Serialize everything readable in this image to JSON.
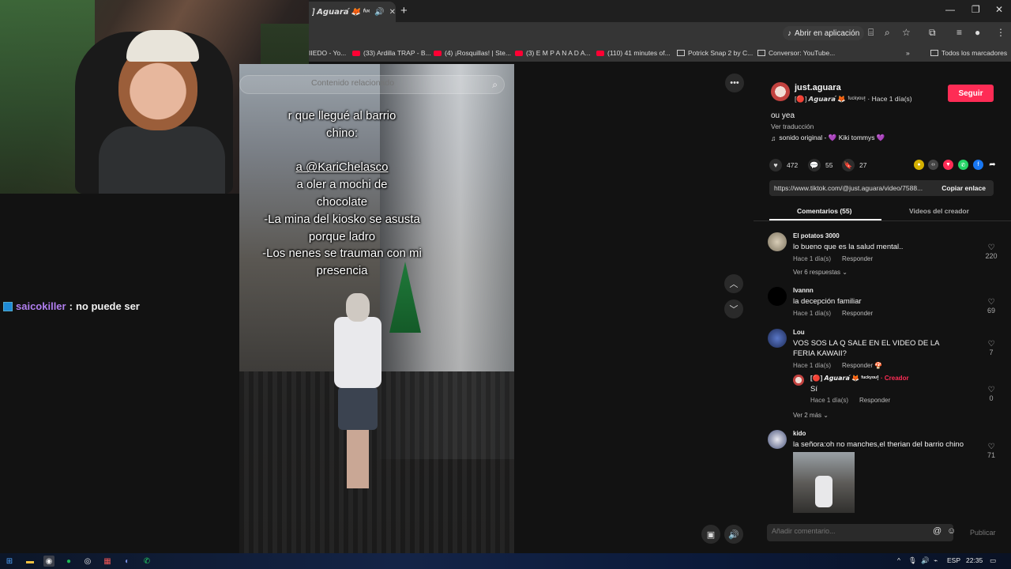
{
  "browser": {
    "tab_title": "] 𝘼𝙜𝙪𝙖𝙧𝙖́ 🦊 ᶠᵘᶜᵏʸᵒᵘ!",
    "new_tab": "+",
    "open_in_app": "Abrir en aplicación",
    "window_controls": [
      "—",
      "❐",
      "✕"
    ]
  },
  "bookmarks": [
    {
      "label": "IIEDO - Yo...",
      "icon": "youtube-icon"
    },
    {
      "label": "(33) Ardilla TRAP - B...",
      "icon": "youtube-icon"
    },
    {
      "label": "(4) ¡Rosquillas! | Ste...",
      "icon": "youtube-icon"
    },
    {
      "label": "(3) E M P A N A D A...",
      "icon": "youtube-icon"
    },
    {
      "label": "(110) 41 minutes of...",
      "icon": "youtube-icon"
    },
    {
      "label": "Potrick Snap 2 by C...",
      "icon": "site-icon"
    },
    {
      "label": "Conversor: YouTube...",
      "icon": "site-icon"
    }
  ],
  "bookmarks_more": "»",
  "all_bookmarks": "Todos los marcadores",
  "stream_chat": {
    "user": "saicokiller",
    "separator": ":",
    "message": "no puede ser"
  },
  "video": {
    "search_placeholder": "Contenido relacionado",
    "overlay_lines": [
      "r que llegué al barrio",
      "chino:",
      "",
      "a @KariChelasco",
      "a oler a mochi de",
      "chocolate",
      "-La mina del kiosko se asusta",
      "porque ladro",
      "-Los nenes se trauman con mi",
      "presencia"
    ]
  },
  "author": {
    "username": "just.aguara",
    "display_name": "[🔴] 𝘼𝙜𝙪𝙖𝙧𝙖́ 🦊 ᶠᵘᶜᵏʸᵒᵘ!",
    "time": "Hace 1 día(s)",
    "follow": "Seguir",
    "caption": "ou yea",
    "see_translation": "Ver traducción",
    "sound": "sonido original - 💜 Kiki tommys 💜"
  },
  "stats": {
    "likes": "472",
    "comments": "55",
    "saves": "27"
  },
  "link": {
    "url": "https://www.tiktok.com/@just.aguara/video/7588...",
    "copy": "Copiar enlace"
  },
  "panel_tabs": {
    "comments": "Comentarios (55)",
    "creator_videos": "Videos del creador"
  },
  "comments": [
    {
      "user": "El potatos 3000",
      "text": "lo bueno que es la salud mental..",
      "time": "Hace 1 día(s)",
      "reply": "Responder",
      "likes": "220",
      "more": "Ver 6 respuestas"
    },
    {
      "user": "Ivannn",
      "text": "la decepción familiar",
      "time": "Hace 1 día(s)",
      "reply": "Responder",
      "likes": "69"
    },
    {
      "user": "Lou",
      "text": "VOS SOS LA Q SALE EN EL VIDEO DE LA FERIA KAWAII?",
      "time": "Hace 1 día(s)",
      "reply": "Responder",
      "likes": "7"
    },
    {
      "user": "[🔴] 𝘼𝙜𝙪𝙖𝙧𝙖́ 🦊 ᶠᵘᶜᵏʸᵒᵘ!",
      "creator": "· Creador",
      "text": "Sí",
      "time": "Hace 1 día(s)",
      "reply": "Responder",
      "likes": "0",
      "more": "Ver 2 más"
    },
    {
      "user": "kido",
      "text": "la señora:oh no manches,el therian del barrio chino",
      "likes": "71"
    }
  ],
  "comment_input": {
    "placeholder": "Añadir comentario...",
    "publish": "Publicar"
  },
  "taskbar": {
    "lang": "ESP",
    "time": "22:35"
  },
  "colors": {
    "accent": "#fe2c55",
    "chat_user": "#b17ff0"
  }
}
